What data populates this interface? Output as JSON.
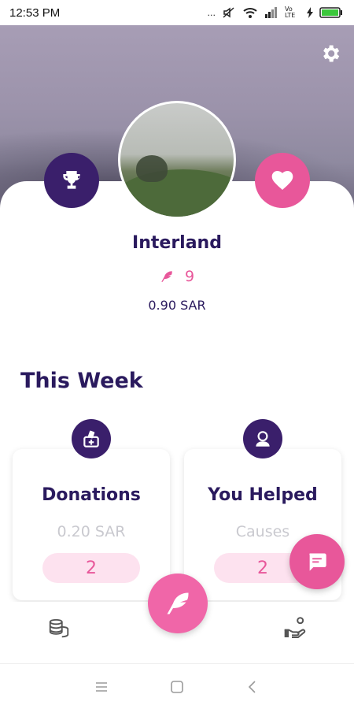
{
  "status_bar": {
    "time": "12:53 PM",
    "dots": "...",
    "network_label": "Vo LTE"
  },
  "profile": {
    "name": "Interland",
    "points": "9",
    "balance": "0.90 SAR"
  },
  "section": {
    "title": "This Week"
  },
  "stats": [
    {
      "title": "Donations",
      "subtitle": "0.20 SAR",
      "count": "2"
    },
    {
      "title": "You Helped",
      "subtitle": "Causes",
      "count": "2"
    }
  ],
  "colors": {
    "primary": "#3a1f6b",
    "accent": "#e8579a",
    "accent_light": "#fde2ef",
    "muted": "#c9c9cf"
  },
  "icons": {
    "settings": "gear-icon",
    "trophy": "trophy-icon",
    "heart": "heart-icon",
    "feather": "feather-icon",
    "donation_box": "donation-box-icon",
    "helper": "person-icon",
    "coins": "coins-icon",
    "hand_help": "hand-help-icon",
    "chat": "chat-icon"
  }
}
